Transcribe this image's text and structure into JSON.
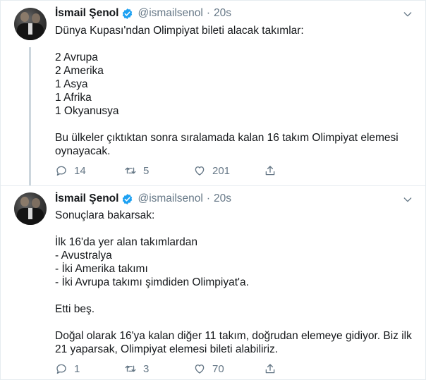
{
  "tweets": [
    {
      "author": {
        "name": "İsmail Şenol",
        "handle": "@ismailsenol"
      },
      "separator": "·",
      "time": "20s",
      "lines": [
        "Dünya Kupası'ndan Olimpiyat bileti alacak takımlar:",
        "",
        "2 Avrupa",
        "2 Amerika",
        "1 Asya",
        "1 Afrika",
        "1 Okyanusya",
        "",
        "Bu ülkeler çıktıktan sonra sıralamada kalan 16 takım Olimpiyat elemesi",
        "oynayacak."
      ],
      "stats": {
        "replies": "14",
        "retweets": "5",
        "likes": "201"
      }
    },
    {
      "author": {
        "name": "İsmail Şenol",
        "handle": "@ismailsenol"
      },
      "separator": "·",
      "time": "20s",
      "lines": [
        "Sonuçlara bakarsak:",
        "",
        "İlk 16'da yer alan takımlardan",
        "- Avustralya",
        "- İki Amerika takımı",
        "- İki Avrupa takımı şimdiden Olimpiyat'a.",
        "",
        "Etti beş.",
        "",
        "Doğal olarak 16'ya kalan diğer 11 takım, doğrudan elemeye gidiyor. Biz ilk",
        "21 yaparsak, Olimpiyat elemesi bileti alabiliriz."
      ],
      "stats": {
        "replies": "1",
        "retweets": "3",
        "likes": "70"
      }
    }
  ],
  "colors": {
    "text": "#14171a",
    "secondary": "#657786",
    "verified": "#1da1f2",
    "thread_line": "#ccd6dd",
    "divider": "#e6ecf0"
  },
  "icons": [
    "reply-icon",
    "retweet-icon",
    "like-icon",
    "share-icon",
    "verified-badge-icon",
    "chevron-down-icon"
  ]
}
